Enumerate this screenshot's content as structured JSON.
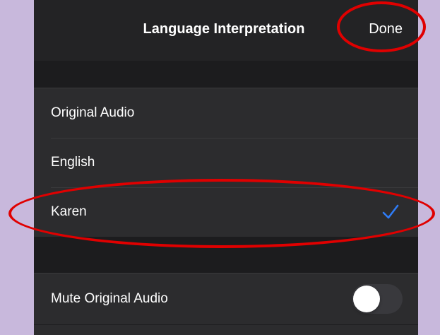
{
  "header": {
    "title": "Language Interpretation",
    "done_label": "Done"
  },
  "options": [
    {
      "label": "Original Audio",
      "selected": false
    },
    {
      "label": "English",
      "selected": false
    },
    {
      "label": "Karen",
      "selected": true
    }
  ],
  "settings": {
    "mute_label": "Mute Original Audio",
    "mute_enabled": false
  },
  "colors": {
    "checkmark": "#2f7cf6",
    "annotation": "#e00000",
    "background": "#c8b8dc"
  }
}
